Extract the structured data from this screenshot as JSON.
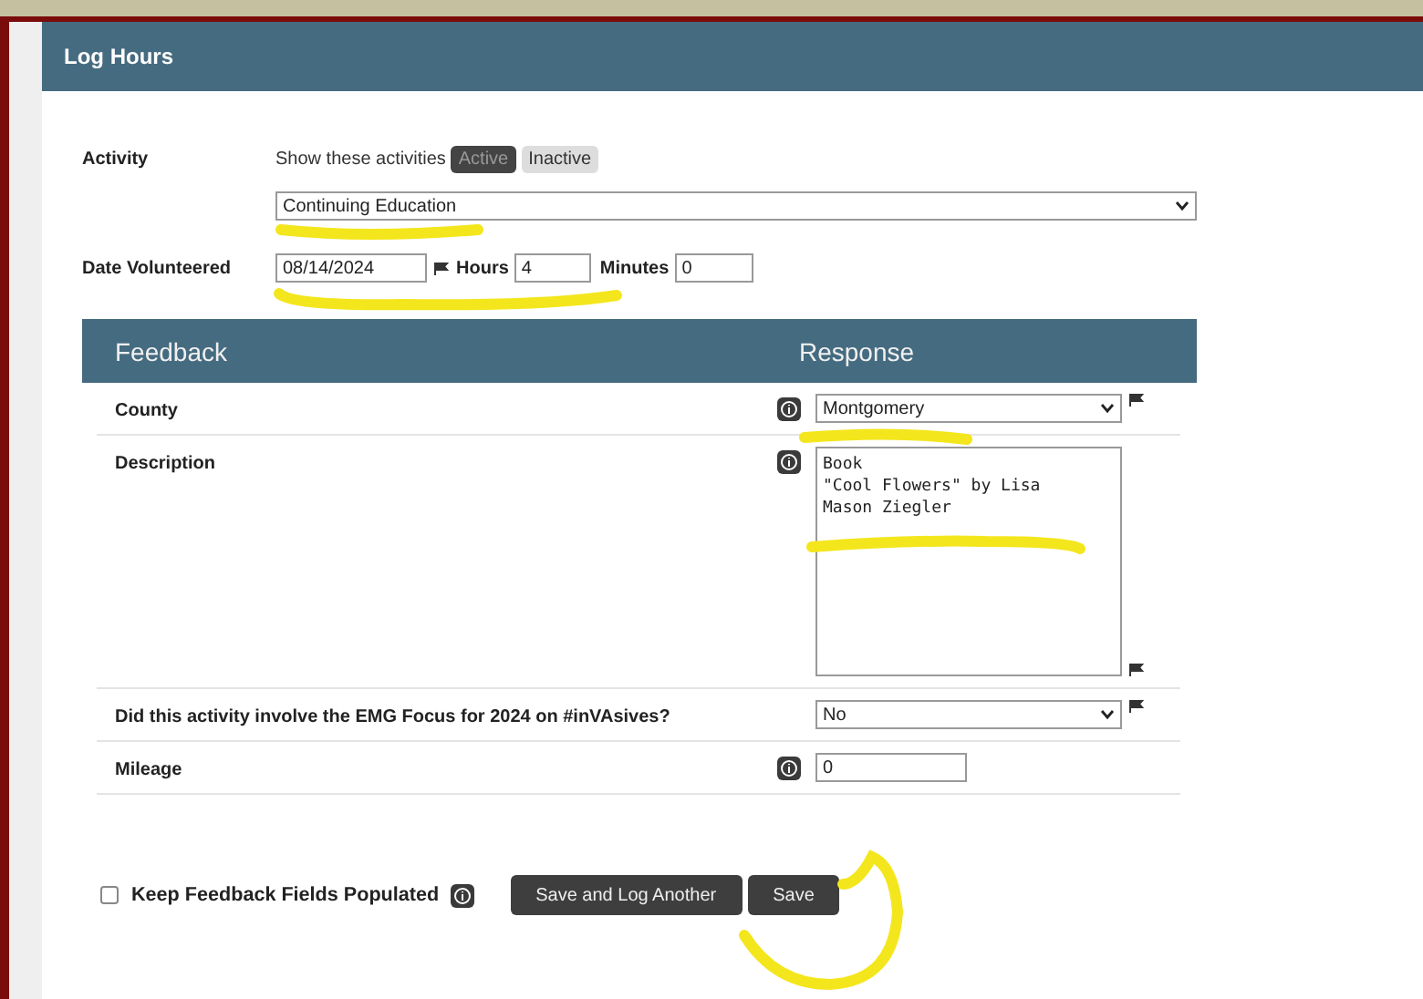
{
  "panel": {
    "title": "Log Hours"
  },
  "activity": {
    "label": "Activity",
    "filter_label": "Show these activities",
    "filters": [
      {
        "label": "Active",
        "selected": true
      },
      {
        "label": "Inactive",
        "selected": false
      }
    ],
    "value": "Continuing Education"
  },
  "date": {
    "label": "Date Volunteered",
    "value": "08/14/2024",
    "hours_label": "Hours",
    "hours": "4",
    "minutes_label": "Minutes",
    "minutes": "0"
  },
  "feedback": {
    "columns": [
      "Feedback",
      "Response"
    ],
    "rows": [
      {
        "label": "County",
        "kind": "select",
        "info": true,
        "flagged": true,
        "value": "Montgomery"
      },
      {
        "label": "Description",
        "kind": "textarea",
        "info": true,
        "flagged": true,
        "value": "Book\n\"Cool Flowers\" by Lisa\nMason Ziegler"
      },
      {
        "label": "Did this activity involve the EMG Focus for 2024 on #inVAsives?",
        "kind": "select",
        "info": false,
        "flagged": true,
        "value": "No"
      },
      {
        "label": "Mileage",
        "kind": "text",
        "info": true,
        "flagged": false,
        "value": "0"
      }
    ]
  },
  "keep_populated": {
    "label": "Keep Feedback Fields Populated",
    "checked": false
  },
  "buttons": [
    "Save and Log Another",
    "Save"
  ]
}
